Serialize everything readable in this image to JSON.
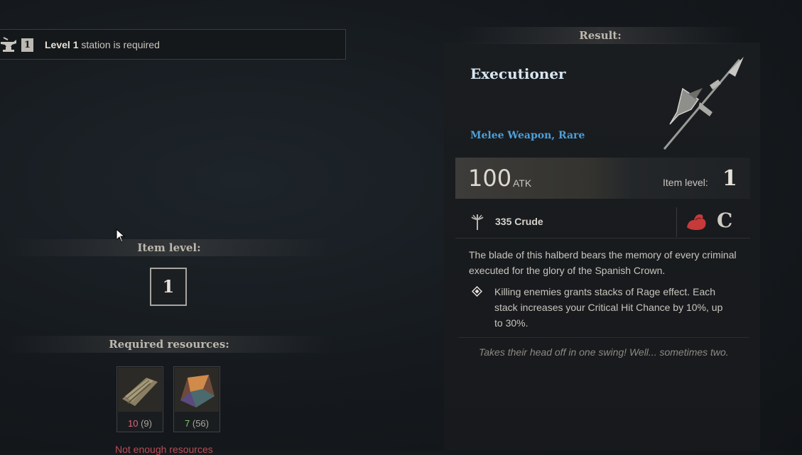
{
  "station": {
    "level": "1",
    "level_text": "Level 1",
    "suffix": " station is required"
  },
  "left": {
    "item_level_header": "Item level:",
    "item_level_value": "1",
    "required_header": "Required resources:",
    "resources": [
      {
        "icon": "wood-icon",
        "need": "10",
        "have": "(9)"
      },
      {
        "icon": "ore-icon",
        "need": "7",
        "have": "(56)"
      }
    ],
    "warning": "Not enough resources"
  },
  "result": {
    "header": "Result:",
    "title": "Executioner",
    "type": "Melee Weapon, Rare",
    "atk_value": "100",
    "atk_label": "ATK",
    "item_level_label": "Item level:",
    "item_level_value": "1",
    "scaling_value": "335 Crude",
    "grade": "C",
    "description": "The blade of this halberd bears the memory of every criminal executed for the glory of the Spanish Crown.",
    "perk": "Killing enemies grants stacks of Rage effect. Each stack increases your Critical Hit Chance by 10%, up to 30%.",
    "flavor": "Takes their head off in one swing! Well... sometimes two."
  },
  "colors": {
    "item_type": "#4f9fd8",
    "need": "#e0657a",
    "have_ok": "#7fcc6e"
  }
}
